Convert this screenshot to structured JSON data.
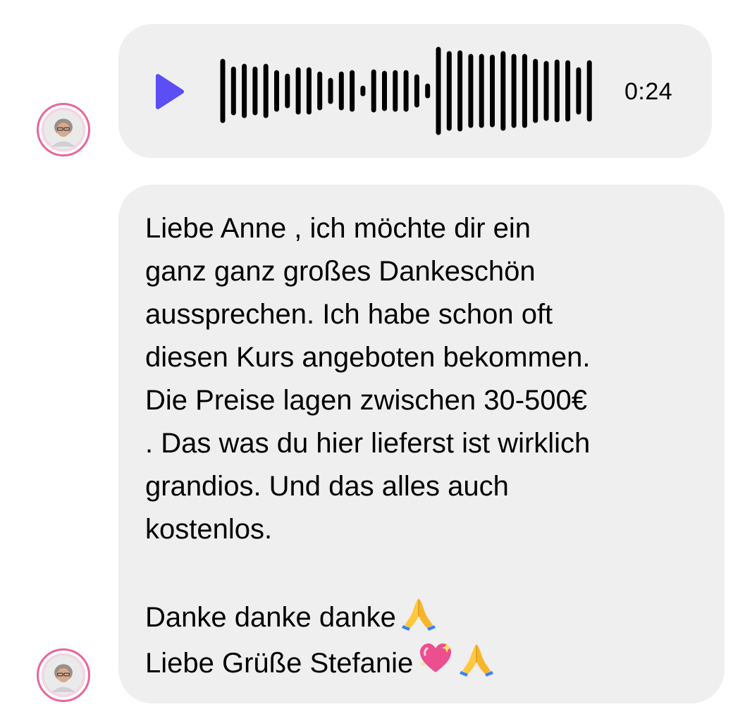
{
  "voice_message": {
    "duration": "0:24",
    "play_icon": "play-icon",
    "accent_color": "#5b4ef5"
  },
  "text_message": {
    "body": "Liebe Anne , ich möchte dir ein\nganz ganz großes Dankeschön\naussprechen. Ich habe schon oft\ndiesen Kurs angeboten bekommen.\nDie Preise lagen zwischen 30-500€\n. Das was du hier lieferst ist wirklich\ngrandios. Und das alles auch\nkostenlos.",
    "sign_off_line_1": "Danke danke danke",
    "sign_off_line_2": "Liebe Grüße Stefanie",
    "emojis": [
      "folded-hands-icon",
      "sparkling-heart-icon",
      "folded-hands-icon"
    ]
  },
  "colors": {
    "bubble_background": "#efeff0",
    "avatar_ring": "#e8669b"
  }
}
